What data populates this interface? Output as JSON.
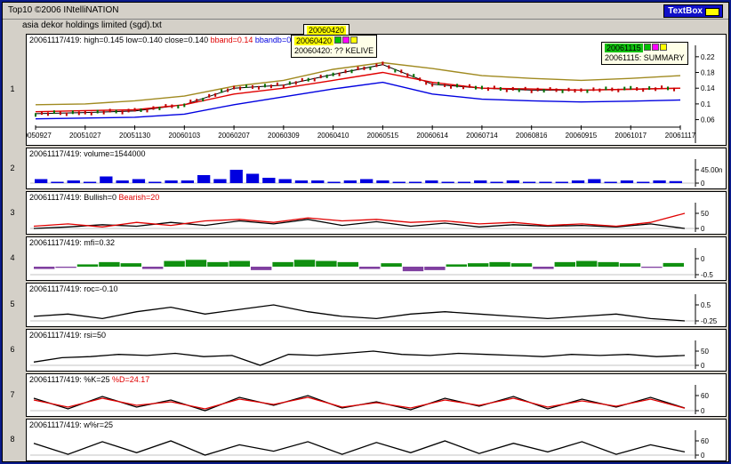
{
  "app": {
    "title": "Top10 ©2006 INtelliNATION",
    "textbox_label": "TextBox"
  },
  "file": {
    "name": "asia dekor holdings limited (sgd).txt"
  },
  "notes": [
    {
      "date": "20060420",
      "text": "20060420: ?? KELIVE",
      "behind_date": "20060420"
    },
    {
      "date": "20061115",
      "text": "20061115: SUMMARY"
    }
  ],
  "panels": [
    {
      "num": "1",
      "label": [
        {
          "text": "20061117/419: high=0.145  low=0.140  close=0.140 ",
          "color": "black"
        },
        {
          "text": "bband=0.14 ",
          "color": "red"
        },
        {
          "text": "bbandb=0.1",
          "color": "blue"
        }
      ]
    },
    {
      "num": "2",
      "label": [
        {
          "text": "20061117/419: volume=1544000",
          "color": "black"
        }
      ]
    },
    {
      "num": "3",
      "label": [
        {
          "text": "20061117/419: Bullish=0 ",
          "color": "black"
        },
        {
          "text": "Bearish=20",
          "color": "red"
        }
      ]
    },
    {
      "num": "4",
      "label": [
        {
          "text": "20061117/419: mfi=0.32",
          "color": "black"
        }
      ]
    },
    {
      "num": "5",
      "label": [
        {
          "text": "20061117/419: roc=-0.10",
          "color": "black"
        }
      ]
    },
    {
      "num": "6",
      "label": [
        {
          "text": "20061117/419: rsi=50",
          "color": "black"
        }
      ]
    },
    {
      "num": "7",
      "label": [
        {
          "text": "20061117/419: %K=25 ",
          "color": "black"
        },
        {
          "text": "%D=24.17",
          "color": "red"
        }
      ]
    },
    {
      "num": "8",
      "label": [
        {
          "text": "20061117/419: w%r=25",
          "color": "black"
        }
      ]
    }
  ],
  "chart_data": [
    {
      "type": "line",
      "panel": "price",
      "x_dates": [
        "20050927",
        "20051027",
        "20051130",
        "20060103",
        "20060207",
        "20060309",
        "20060410",
        "20060515",
        "20060614",
        "20060714",
        "20060816",
        "20060915",
        "20061017",
        "20061117"
      ],
      "ytick_labels": [
        "0.22",
        "0.18",
        "0.14",
        "0.1",
        "0.06"
      ],
      "ylim": [
        0.05,
        0.24
      ],
      "series": [
        {
          "key": "close",
          "values": [
            0.075,
            0.078,
            0.082,
            0.098,
            0.14,
            0.148,
            0.175,
            0.2,
            0.15,
            0.14,
            0.135,
            0.135,
            0.138,
            0.14
          ]
        },
        {
          "key": "bband",
          "color": "#e00000",
          "values": [
            0.08,
            0.083,
            0.085,
            0.098,
            0.125,
            0.14,
            0.16,
            0.18,
            0.155,
            0.14,
            0.138,
            0.135,
            0.137,
            0.14
          ]
        },
        {
          "key": "bband_upper",
          "color": "#a08a20",
          "values": [
            0.098,
            0.1,
            0.108,
            0.12,
            0.145,
            0.16,
            0.188,
            0.205,
            0.19,
            0.172,
            0.165,
            0.16,
            0.165,
            0.172
          ]
        },
        {
          "key": "bbandb",
          "color": "#0000e0",
          "values": [
            0.062,
            0.064,
            0.066,
            0.074,
            0.098,
            0.118,
            0.138,
            0.155,
            0.125,
            0.112,
            0.108,
            0.105,
            0.107,
            0.11
          ]
        }
      ]
    },
    {
      "type": "bar",
      "panel": "volume",
      "ytick_labels": [
        "45.00n",
        "0"
      ],
      "values": [
        0.3,
        0.1,
        0.2,
        0.1,
        0.5,
        0.2,
        0.3,
        0.1,
        0.2,
        0.2,
        0.6,
        0.3,
        1.0,
        0.7,
        0.4,
        0.3,
        0.2,
        0.2,
        0.1,
        0.2,
        0.3,
        0.2,
        0.1,
        0.1,
        0.2,
        0.1,
        0.1,
        0.2,
        0.1,
        0.2,
        0.1,
        0.1,
        0.1,
        0.2,
        0.3,
        0.1,
        0.2,
        0.1,
        0.2,
        0.15
      ],
      "color": "#0000e0"
    },
    {
      "type": "line",
      "panel": "bullish-bearish",
      "ytick_labels": [
        "50",
        "0"
      ],
      "series": [
        {
          "key": "bullish",
          "color": "#000000",
          "values": [
            0,
            2,
            5,
            3,
            8,
            4,
            10,
            6,
            12,
            4,
            9,
            3,
            7,
            2,
            5,
            3,
            4,
            2,
            6,
            0
          ]
        },
        {
          "key": "bearish",
          "color": "#e00000",
          "values": [
            3,
            6,
            2,
            8,
            4,
            10,
            12,
            8,
            14,
            10,
            12,
            8,
            10,
            6,
            8,
            4,
            6,
            3,
            8,
            20
          ]
        }
      ]
    },
    {
      "type": "bar",
      "panel": "mfi",
      "ytick_labels": [
        "0",
        "-0.5"
      ],
      "values": [
        -0.2,
        -0.1,
        0.2,
        0.4,
        0.3,
        -0.2,
        0.5,
        0.6,
        0.4,
        0.5,
        -0.3,
        0.4,
        0.6,
        0.5,
        0.4,
        -0.2,
        0.3,
        -0.4,
        -0.3,
        0.2,
        0.3,
        0.4,
        0.3,
        -0.2,
        0.4,
        0.5,
        0.4,
        0.3,
        -0.1,
        0.32
      ]
    },
    {
      "type": "line",
      "panel": "roc",
      "ytick_labels": [
        "0.5",
        "-0.25"
      ],
      "series": [
        {
          "key": "roc",
          "color": "#000000",
          "values": [
            0,
            0.05,
            -0.05,
            0.1,
            0.2,
            0.05,
            0.15,
            0.25,
            0.1,
            0,
            -0.05,
            0.05,
            0.1,
            0.05,
            0,
            -0.05,
            0,
            0.05,
            -0.05,
            -0.1
          ]
        }
      ]
    },
    {
      "type": "line",
      "panel": "rsi",
      "ytick_labels": [
        "50",
        "0"
      ],
      "series": [
        {
          "key": "rsi",
          "color": "#000000",
          "values": [
            20,
            40,
            45,
            55,
            50,
            60,
            45,
            50,
            5,
            55,
            50,
            60,
            70,
            55,
            50,
            60,
            55,
            50,
            45,
            55,
            50,
            55,
            45,
            50
          ]
        }
      ]
    },
    {
      "type": "line",
      "panel": "stochastic",
      "ytick_labels": [
        "60",
        "0"
      ],
      "series": [
        {
          "key": "%K",
          "color": "#000000",
          "values": [
            80,
            20,
            90,
            30,
            70,
            10,
            85,
            40,
            95,
            25,
            60,
            15,
            80,
            35,
            90,
            20,
            75,
            30,
            85,
            25
          ]
        },
        {
          "key": "%D",
          "color": "#e00000",
          "values": [
            70,
            30,
            80,
            40,
            60,
            20,
            75,
            45,
            85,
            30,
            55,
            25,
            70,
            40,
            80,
            30,
            65,
            35,
            75,
            24.17
          ]
        }
      ]
    },
    {
      "type": "line",
      "panel": "williams",
      "ytick_labels": [
        "60",
        "0"
      ],
      "series": [
        {
          "key": "w%r",
          "color": "#000000",
          "values": [
            80,
            10,
            90,
            20,
            95,
            5,
            70,
            30,
            90,
            10,
            85,
            20,
            95,
            15,
            80,
            25,
            90,
            10,
            70,
            25
          ]
        }
      ]
    }
  ]
}
